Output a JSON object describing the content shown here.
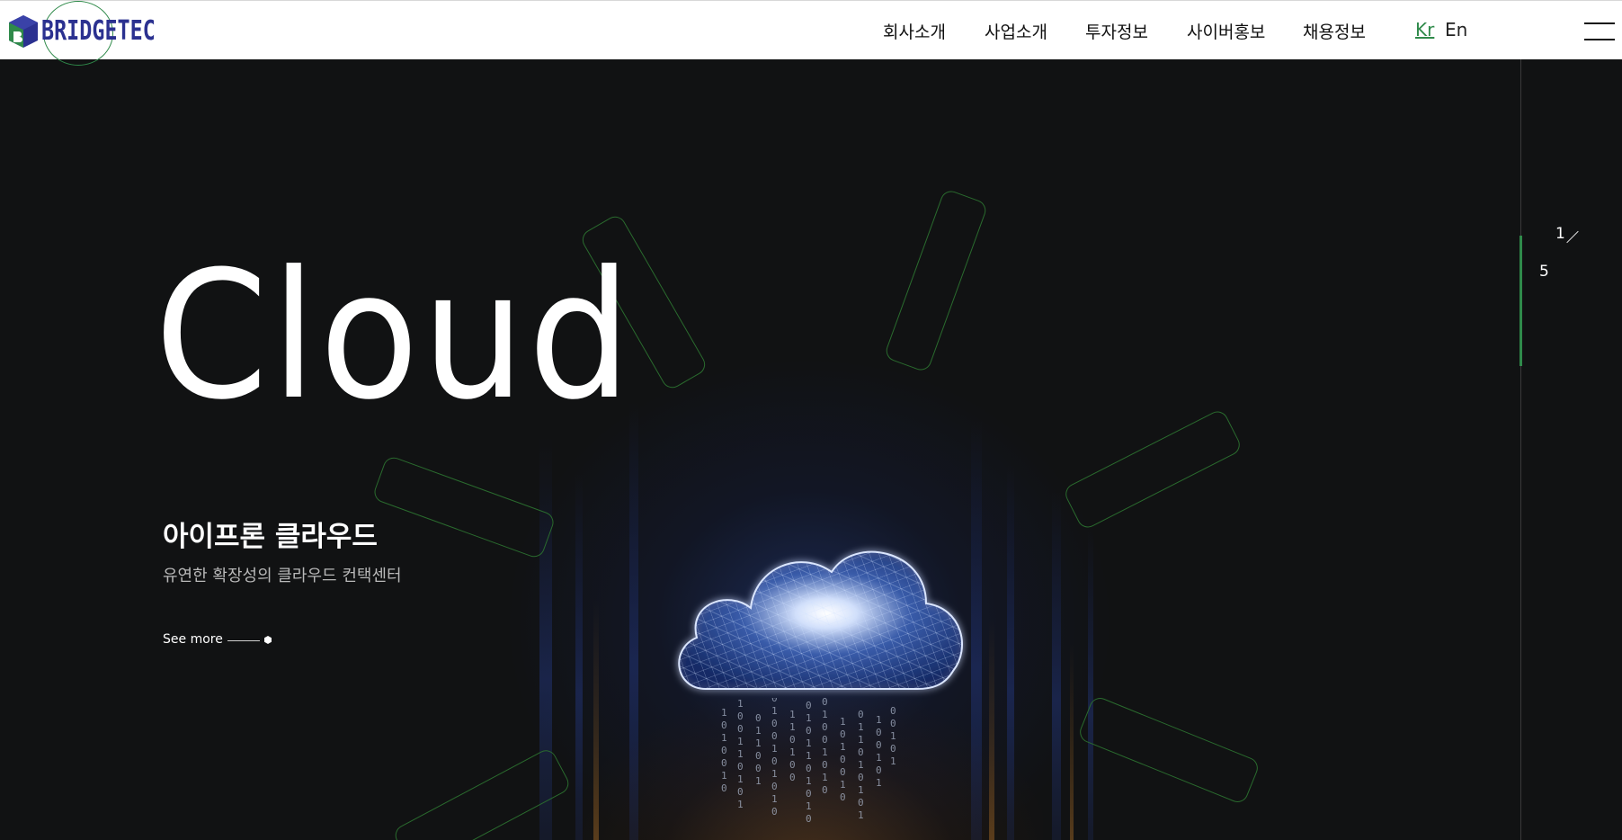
{
  "brand": {
    "name": "BRIDGETEC",
    "brand_color": "#2b3190",
    "accent_color": "#2f8a4a"
  },
  "nav": {
    "items": [
      {
        "label": "회사소개"
      },
      {
        "label": "사업소개"
      },
      {
        "label": "투자정보"
      },
      {
        "label": "사이버홍보"
      },
      {
        "label": "채용정보"
      }
    ],
    "lang_kr": "Kr",
    "lang_en": "En",
    "menu_icon": "hamburger-menu-icon"
  },
  "hero": {
    "title": "Cloud",
    "subtitle": "아이프론 클라우드",
    "description": "유연한 확장성의 클라우드 컨택센터",
    "see_more_label": "See more",
    "image": "glowing-network-cloud-illustration"
  },
  "pagination": {
    "current": "1",
    "total": "5"
  }
}
